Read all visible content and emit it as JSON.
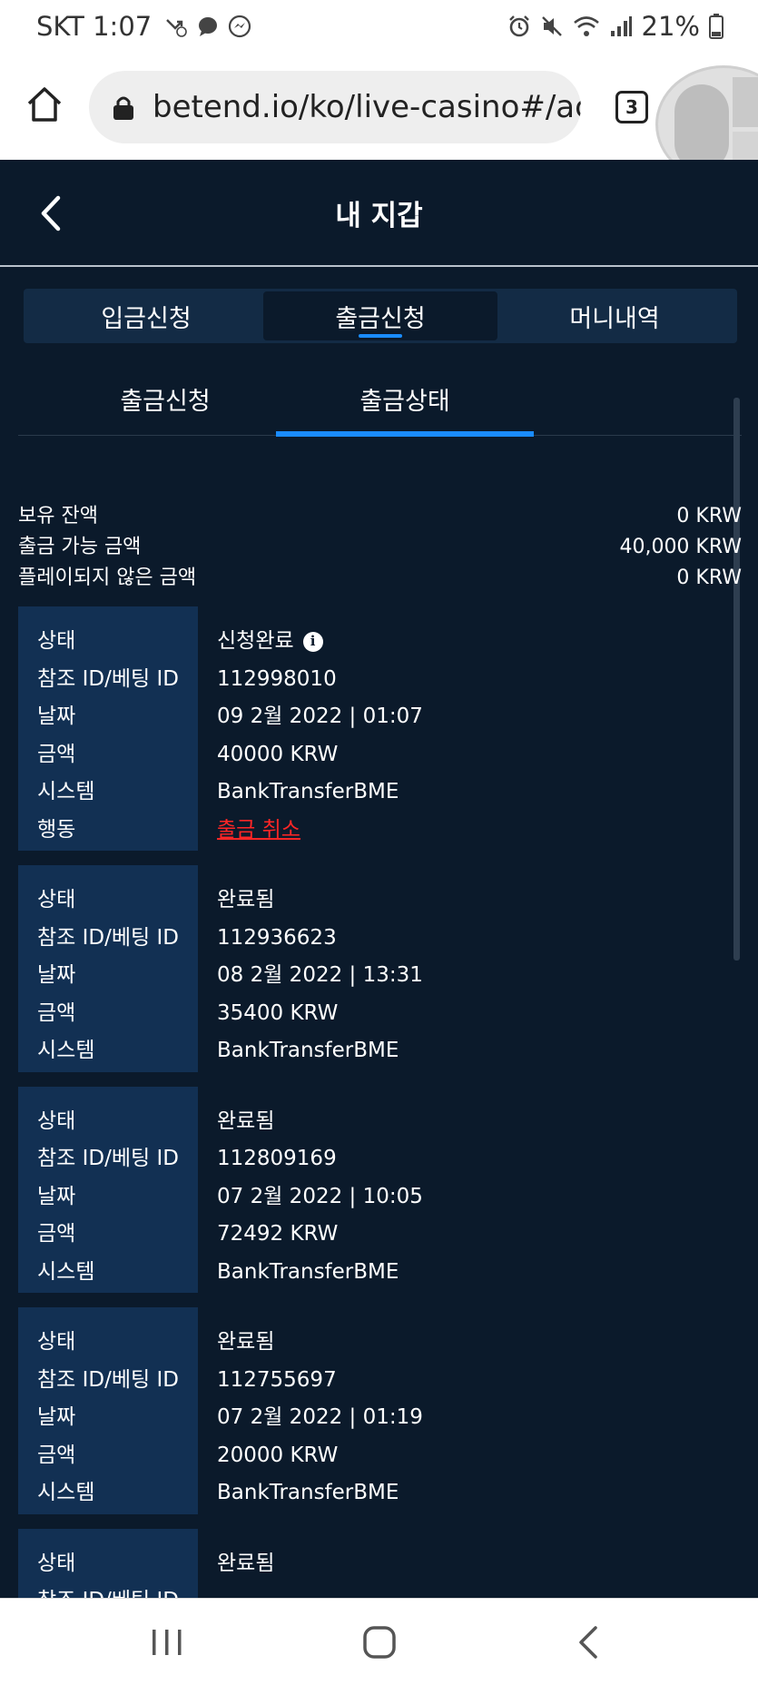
{
  "status_bar": {
    "carrier_time": "SKT 1:07",
    "battery": "21%"
  },
  "browser": {
    "url": "betend.io/ko/live-casino#/ac",
    "tab_count": "3"
  },
  "header": {
    "title": "내 지갑"
  },
  "tabs": [
    {
      "label": "입금신청",
      "active": false
    },
    {
      "label": "출금신청",
      "active": true
    },
    {
      "label": "머니내역",
      "active": false
    }
  ],
  "subtabs": [
    {
      "label": "출금신청",
      "active": false
    },
    {
      "label": "출금상태",
      "active": true
    }
  ],
  "balances": [
    {
      "label": "보유 잔액",
      "value": "0 KRW"
    },
    {
      "label": "출금 가능 금액",
      "value": "40,000 KRW"
    },
    {
      "label": "플레이되지 않은 금액",
      "value": "0 KRW"
    }
  ],
  "field_labels": {
    "status": "상태",
    "ref_id": "참조 ID/베팅 ID",
    "date": "날짜",
    "amount": "금액",
    "system": "시스템",
    "action": "행동"
  },
  "records": [
    {
      "status": "신청완료",
      "ref_id": "112998010",
      "date": "09 2월 2022 | 01:07",
      "amount": "40000 KRW",
      "system": "BankTransferBME",
      "action": "출금 취소"
    },
    {
      "status": "완료됨",
      "ref_id": "112936623",
      "date": "08 2월 2022 | 13:31",
      "amount": "35400 KRW",
      "system": "BankTransferBME"
    },
    {
      "status": "완료됨",
      "ref_id": "112809169",
      "date": "07 2월 2022 | 10:05",
      "amount": "72492 KRW",
      "system": "BankTransferBME"
    },
    {
      "status": "완료됨",
      "ref_id": "112755697",
      "date": "07 2월 2022 | 01:19",
      "amount": "20000 KRW",
      "system": "BankTransferBME"
    },
    {
      "status": "완료됨",
      "ref_id": "",
      "date": "",
      "amount": "",
      "system": ""
    }
  ],
  "colors": {
    "background": "#0b1a2b",
    "label_panel": "#123053",
    "accent": "#1a8cff",
    "danger": "#ff2626"
  }
}
